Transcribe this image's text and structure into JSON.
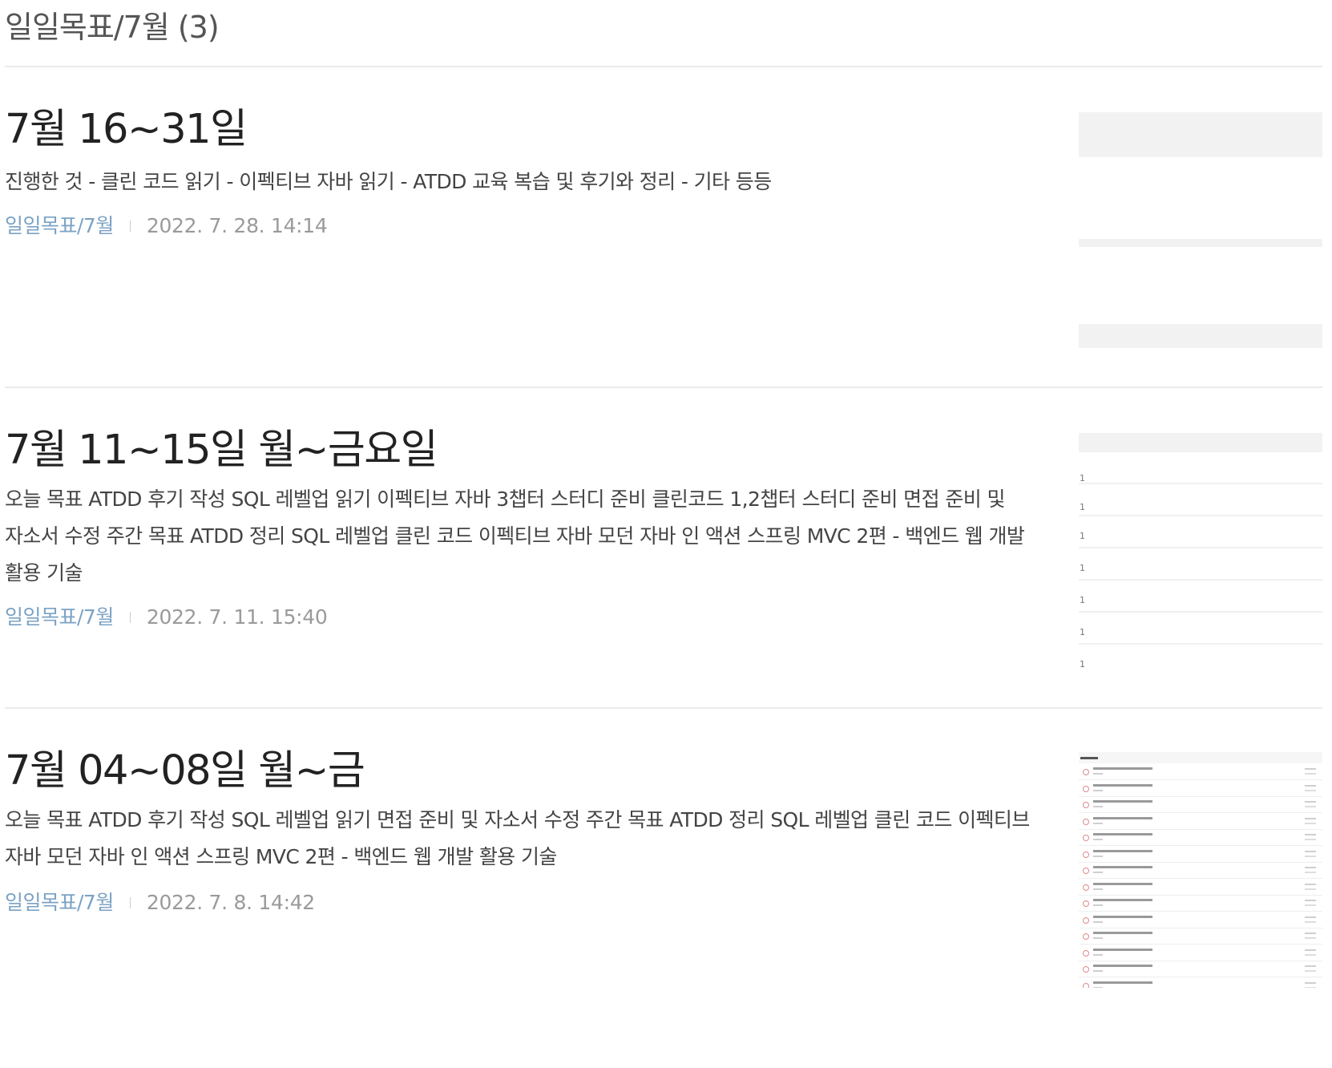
{
  "category_header": {
    "title": "일일목표/7월 (3)"
  },
  "posts": [
    {
      "title": "7월 16~31일",
      "excerpt": "진행한 것 - 클린 코드 읽기 - 이펙티브 자바 읽기 - ATDD 교육 복습 및 후기와 정리 - 기타 등등",
      "category": "일일목표/7월",
      "date": "2022. 7. 28. 14:14"
    },
    {
      "title": "7월 11~15일 월~금요일",
      "excerpt": "오늘 목표 ATDD 후기 작성 SQL 레벨업 읽기 이펙티브 자바 3챕터 스터디 준비 클린코드 1,2챕터 스터디 준비 면접 준비 및 자소서 수정 주간 목표 ATDD 정리 SQL 레벨업 클린 코드 이펙티브 자바 모던 자바 인 액션 스프링 MVC 2편 - 백엔드 웹 개발 활용 기술",
      "category": "일일목표/7월",
      "date": "2022. 7. 11. 15:40",
      "thumbnail_numbers": [
        "1",
        "1",
        "1",
        "1",
        "1",
        "1",
        "1"
      ]
    },
    {
      "title": "7월 04~08일 월~금",
      "excerpt": "오늘 목표 ATDD 후기 작성 SQL 레벨업 읽기 면접 준비 및 자소서 수정 주간 목표 ATDD 정리 SQL 레벨업 클린 코드 이펙티브 자바 모던 자바 인 액션 스프링 MVC 2편 - 백엔드 웹 개발 활용 기술",
      "category": "일일목표/7월",
      "date": "2022. 7. 8. 14:42"
    }
  ],
  "colors": {
    "category_link": "#7ba2c4",
    "date_text": "#9a9a9a",
    "divider": "#ebebeb"
  }
}
